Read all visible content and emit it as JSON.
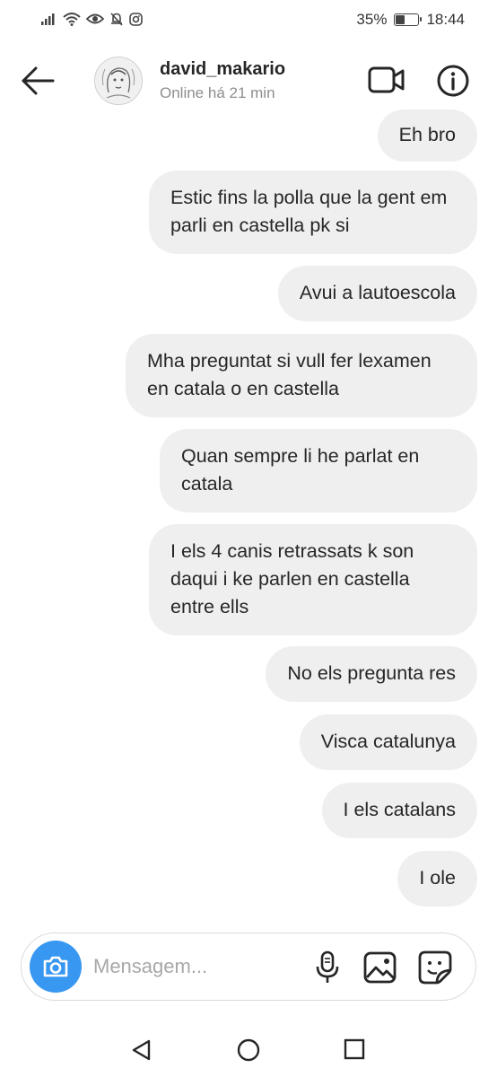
{
  "status_bar": {
    "battery_percent": "35%",
    "time": "18:44"
  },
  "header": {
    "username": "david_makario",
    "presence": "Online há 21 min"
  },
  "messages": [
    {
      "text": "Eh bro"
    },
    {
      "text": "Estic fins la polla que la gent em parli en castella pk si"
    },
    {
      "text": "Avui a lautoescola"
    },
    {
      "text": "Mha preguntat si vull fer lexamen en catala o en castella"
    },
    {
      "text": "Quan sempre li he parlat en catala"
    },
    {
      "text": "I els 4 canis retrassats k son daqui i ke parlen en castella entre ells"
    },
    {
      "text": "No els pregunta res"
    },
    {
      "text": "Visca catalunya"
    },
    {
      "text": "I els catalans"
    },
    {
      "text": "I ole"
    }
  ],
  "composer": {
    "placeholder": "Mensagem..."
  },
  "colors": {
    "bubble_bg": "#efefef",
    "camera_button": "#3897f0",
    "text": "#262626",
    "secondary_text": "#8e8e8e"
  },
  "icons": {
    "back": "arrow-left-icon",
    "video": "video-camera-icon",
    "info": "info-icon",
    "camera": "camera-icon",
    "mic": "microphone-icon",
    "gallery": "image-icon",
    "sticker": "sticker-icon",
    "nav_back": "triangle-back-icon",
    "nav_home": "circle-home-icon",
    "nav_recents": "square-recents-icon"
  }
}
